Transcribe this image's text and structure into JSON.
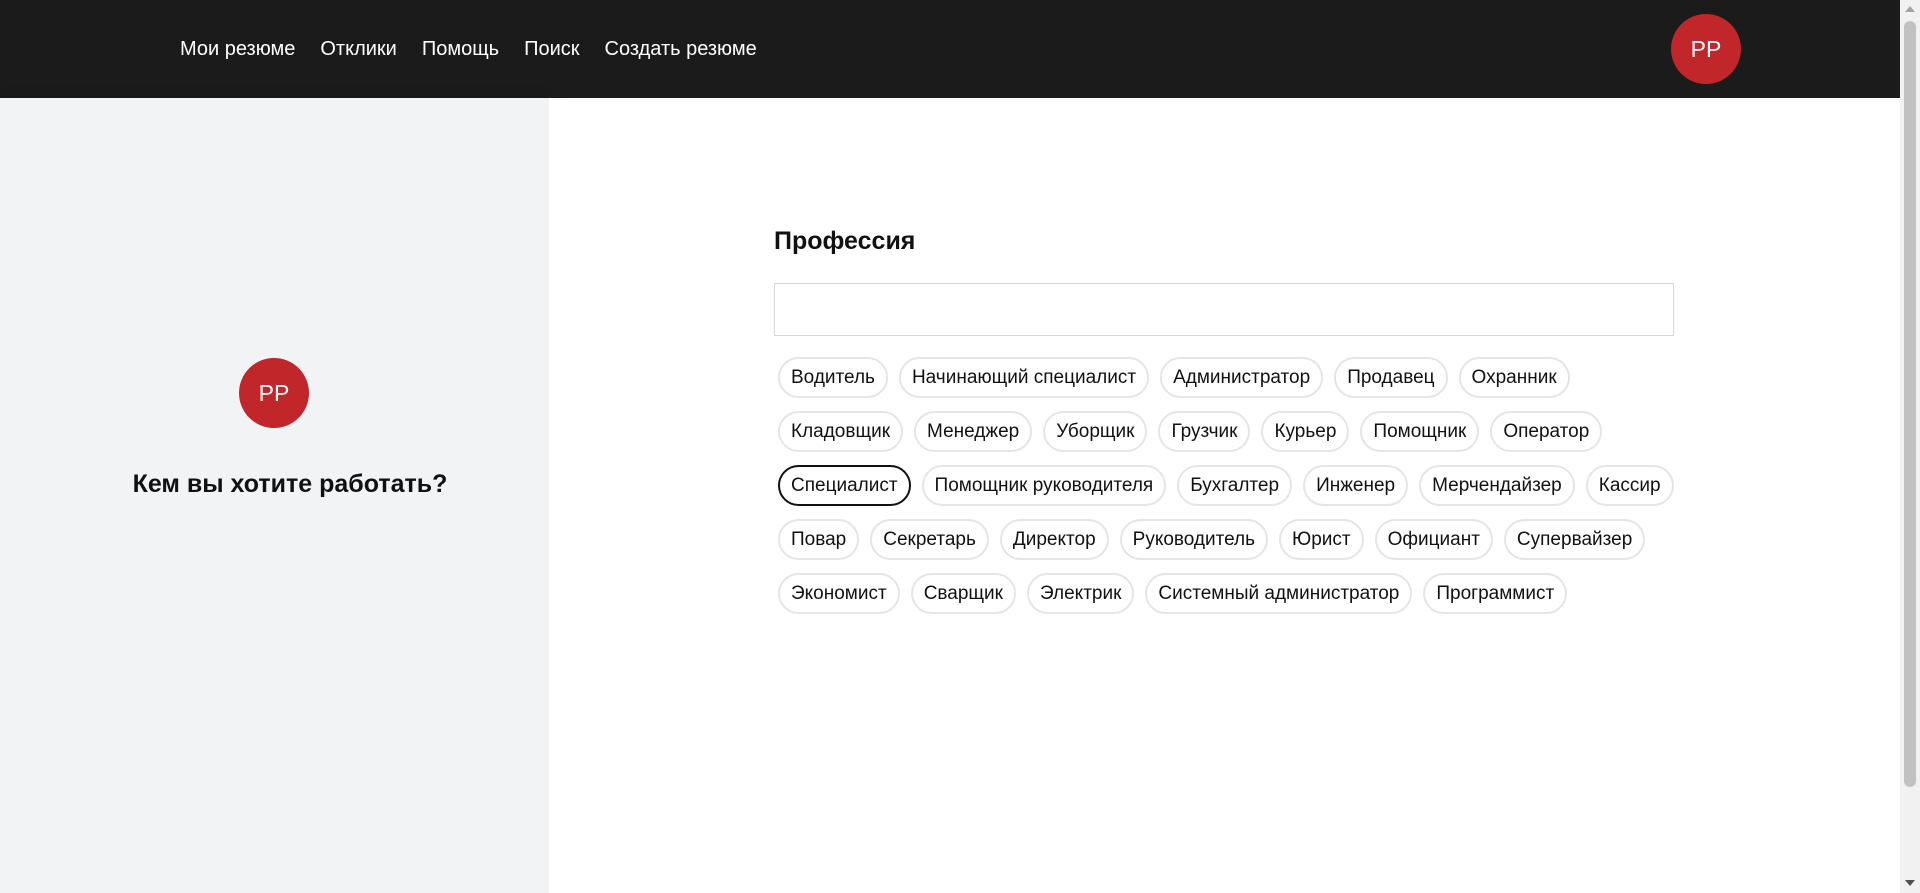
{
  "header": {
    "nav": [
      {
        "label": "Мои резюме"
      },
      {
        "label": "Отклики"
      },
      {
        "label": "Помощь"
      },
      {
        "label": "Поиск"
      },
      {
        "label": "Создать резюме"
      }
    ],
    "avatar_initials": "РР"
  },
  "sidebar": {
    "avatar_initials": "РР",
    "title": "Кем вы хотите работать?"
  },
  "main": {
    "section_title": "Профессия",
    "search_value": "",
    "search_placeholder": "",
    "selected": "Специалист",
    "chips": [
      {
        "label": "Водитель"
      },
      {
        "label": "Начинающий специалист"
      },
      {
        "label": "Администратор"
      },
      {
        "label": "Продавец"
      },
      {
        "label": "Охранник"
      },
      {
        "label": "Кладовщик"
      },
      {
        "label": "Менеджер"
      },
      {
        "label": "Уборщик"
      },
      {
        "label": "Грузчик"
      },
      {
        "label": "Курьер"
      },
      {
        "label": "Помощник"
      },
      {
        "label": "Оператор"
      },
      {
        "label": "Специалист"
      },
      {
        "label": "Помощник руководителя"
      },
      {
        "label": "Бухгалтер"
      },
      {
        "label": "Инженер"
      },
      {
        "label": "Мерчендайзер"
      },
      {
        "label": "Кассир"
      },
      {
        "label": "Повар"
      },
      {
        "label": "Секретарь"
      },
      {
        "label": "Директор"
      },
      {
        "label": "Руководитель"
      },
      {
        "label": "Юрист"
      },
      {
        "label": "Официант"
      },
      {
        "label": "Супервайзер"
      },
      {
        "label": "Экономист"
      },
      {
        "label": "Сварщик"
      },
      {
        "label": "Электрик"
      },
      {
        "label": "Системный администратор"
      },
      {
        "label": "Программист"
      }
    ]
  },
  "colors": {
    "header_bg": "#1b1b1b",
    "avatar_bg": "#c0262a",
    "sidebar_bg": "#f2f3f5",
    "chip_border": "#e5e5e5",
    "chip_selected_border": "#111111"
  }
}
